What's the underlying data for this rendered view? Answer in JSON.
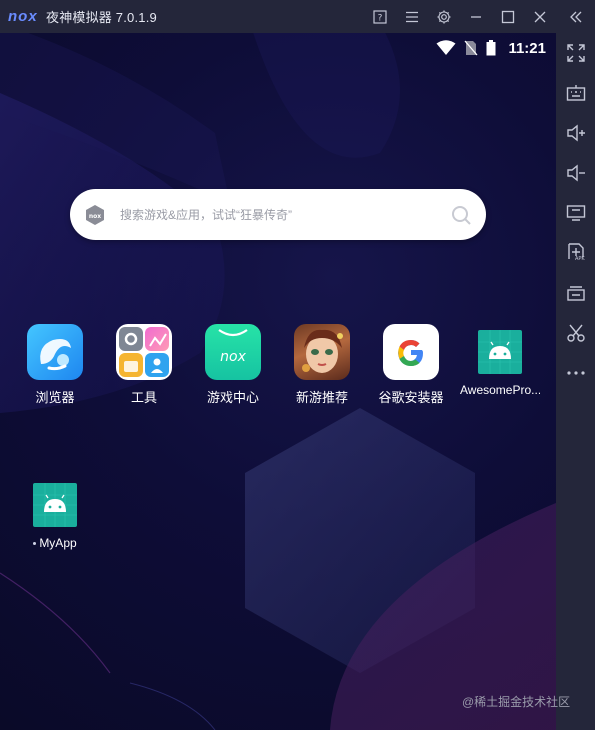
{
  "window": {
    "title": "夜神模拟器 7.0.1.9",
    "logo_text": "nox",
    "controls": [
      "help-icon",
      "menu-icon",
      "gear-icon",
      "minimize-icon",
      "maximize-icon",
      "close-icon",
      "collapse-icon"
    ]
  },
  "statusbar": {
    "time": "11:21",
    "icons": [
      "wifi-icon",
      "no-sim-icon",
      "battery-icon"
    ]
  },
  "search": {
    "placeholder": "搜索游戏&应用，试试“狂暴传奇”"
  },
  "apps": [
    {
      "label": "浏览器",
      "icon": "browser-icon"
    },
    {
      "label": "工具",
      "icon": "tools-folder-icon"
    },
    {
      "label": "游戏中心",
      "icon": "game-center-icon"
    },
    {
      "label": "新游推荐",
      "icon": "new-games-icon"
    },
    {
      "label": "谷歌安装器",
      "icon": "google-installer-icon"
    },
    {
      "label": "AwesomePro...",
      "icon": "android-app-icon"
    },
    {
      "label": "MyApp",
      "icon": "android-app-icon"
    }
  ],
  "sidebar": {
    "items": [
      "fullscreen-icon",
      "keyboard-icon",
      "volume-up-icon",
      "volume-down-icon",
      "screen-icon",
      "add-apk-icon",
      "multi-instance-icon",
      "scissors-icon",
      "more-icon"
    ],
    "apk_badge": "APK"
  },
  "watermark": "@稀土掘金技术社区",
  "colors": {
    "titlebar": "#24263a",
    "screen_bg": "#0e0d38",
    "accent_teal": "#1aaf9d"
  }
}
